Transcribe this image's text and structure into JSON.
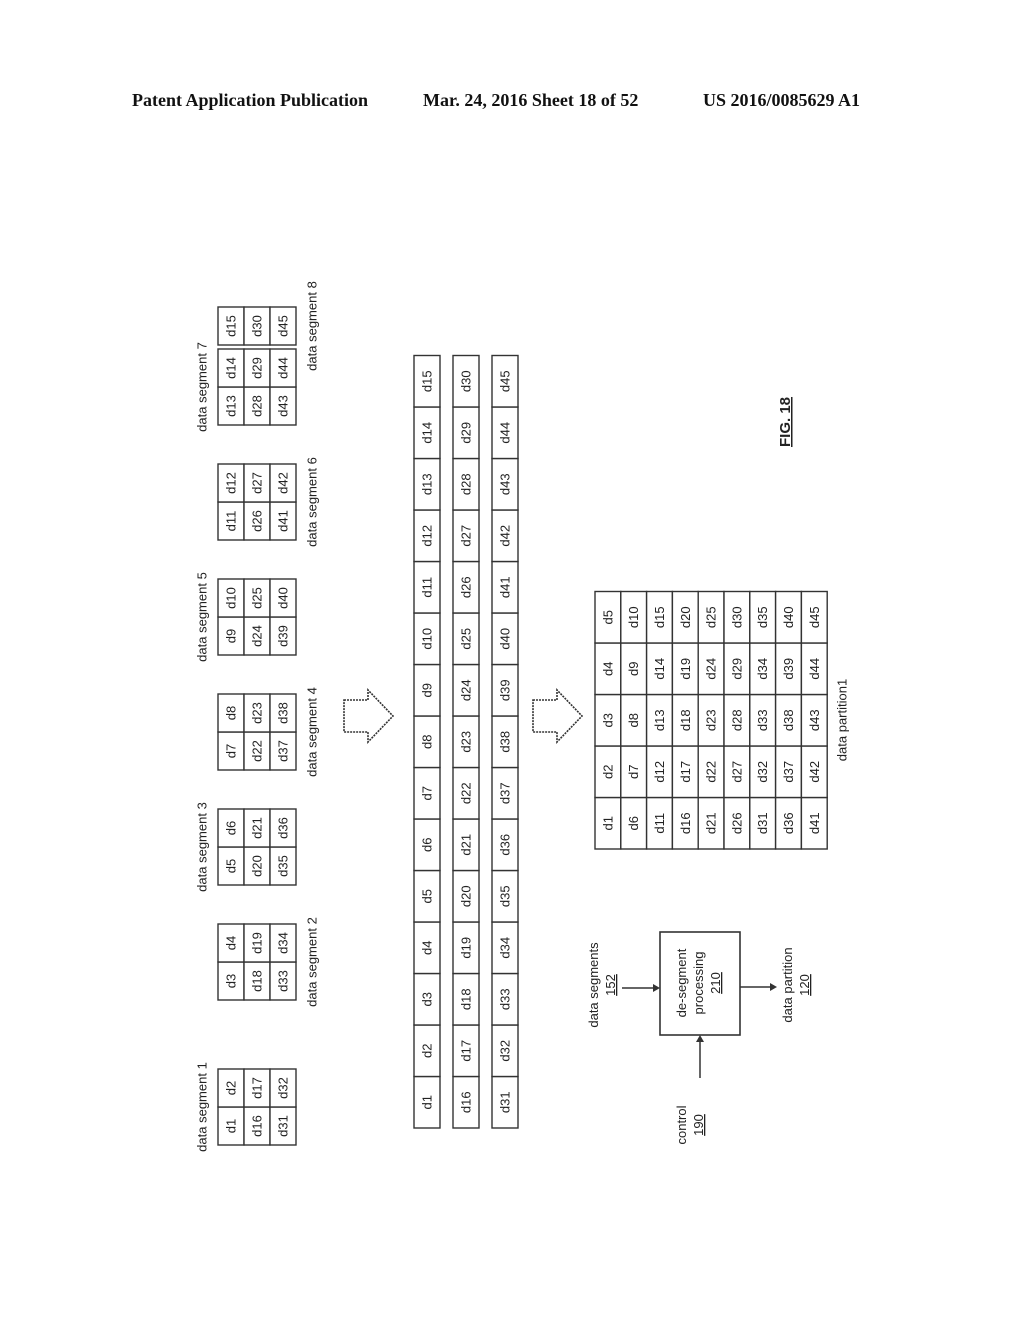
{
  "header": {
    "publication": "Patent Application Publication",
    "date_sheet": "Mar. 24, 2016  Sheet 18 of 52",
    "patent_number": "US 2016/0085629 A1"
  },
  "figure_label": "FIG. 18",
  "segments": [
    {
      "label": "data segment 1",
      "rows": [
        [
          "d1",
          "d2"
        ],
        [
          "d16",
          "d17"
        ],
        [
          "d31",
          "d32"
        ]
      ]
    },
    {
      "label": "data segment 2",
      "rows": [
        [
          "d3",
          "d4"
        ],
        [
          "d18",
          "d19"
        ],
        [
          "d33",
          "d34"
        ]
      ]
    },
    {
      "label": "data segment 3",
      "rows": [
        [
          "d5",
          "d6"
        ],
        [
          "d20",
          "d21"
        ],
        [
          "d35",
          "d36"
        ]
      ]
    },
    {
      "label": "data segment 4",
      "rows": [
        [
          "d7",
          "d8"
        ],
        [
          "d22",
          "d23"
        ],
        [
          "d37",
          "d38"
        ]
      ]
    },
    {
      "label": "data segment 5",
      "rows": [
        [
          "d9",
          "d10"
        ],
        [
          "d24",
          "d25"
        ],
        [
          "d39",
          "d40"
        ]
      ]
    },
    {
      "label": "data segment 6",
      "rows": [
        [
          "d11",
          "d12"
        ],
        [
          "d26",
          "d27"
        ],
        [
          "d41",
          "d42"
        ]
      ]
    },
    {
      "label": "data segment 7",
      "rows": [
        [
          "d13",
          "d14"
        ],
        [
          "d28",
          "d29"
        ],
        [
          "d43",
          "d44"
        ]
      ]
    },
    {
      "label": "data segment 8",
      "rows": [
        [
          "d15"
        ],
        [
          "d30"
        ],
        [
          "d45"
        ]
      ]
    }
  ],
  "strips": [
    [
      "d1",
      "d2",
      "d3",
      "d4",
      "d5",
      "d6",
      "d7",
      "d8",
      "d9",
      "d10",
      "d11",
      "d12",
      "d13",
      "d14",
      "d15"
    ],
    [
      "d16",
      "d17",
      "d18",
      "d19",
      "d20",
      "d21",
      "d22",
      "d23",
      "d24",
      "d25",
      "d26",
      "d27",
      "d28",
      "d29",
      "d30"
    ],
    [
      "d31",
      "d32",
      "d33",
      "d34",
      "d35",
      "d36",
      "d37",
      "d38",
      "d39",
      "d40",
      "d41",
      "d42",
      "d43",
      "d44",
      "d45"
    ]
  ],
  "partition": {
    "label": "data partition1",
    "rows": [
      [
        "d1",
        "d2",
        "d3",
        "d4",
        "d5"
      ],
      [
        "d6",
        "d7",
        "d8",
        "d9",
        "d10"
      ],
      [
        "d11",
        "d12",
        "d13",
        "d14",
        "d15"
      ],
      [
        "d16",
        "d17",
        "d18",
        "d19",
        "d20"
      ],
      [
        "d21",
        "d22",
        "d23",
        "d24",
        "d25"
      ],
      [
        "d26",
        "d27",
        "d28",
        "d29",
        "d30"
      ],
      [
        "d31",
        "d32",
        "d33",
        "d34",
        "d35"
      ],
      [
        "d36",
        "d37",
        "d38",
        "d39",
        "d40"
      ],
      [
        "d41",
        "d42",
        "d43",
        "d44",
        "d45"
      ]
    ]
  },
  "block": {
    "title_line1": "de-segment",
    "title_line2": "processing",
    "ref": "210",
    "input_label": "data segments",
    "input_ref": "152",
    "control_label": "control",
    "control_ref": "190",
    "output_label": "data partition",
    "output_ref": "120"
  }
}
